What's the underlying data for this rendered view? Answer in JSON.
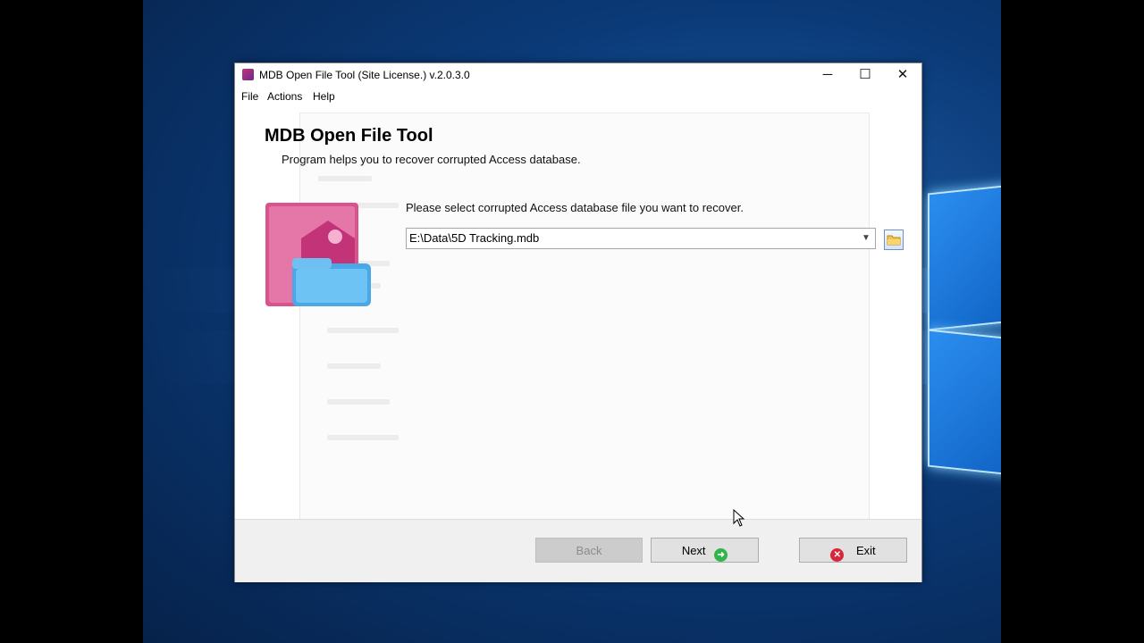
{
  "window": {
    "title": "MDB Open File Tool (Site License.) v.2.0.3.0",
    "controls": {
      "minimize": "─",
      "maximize": "☐",
      "close": "✕"
    }
  },
  "menu": [
    "File",
    "Actions",
    "Help"
  ],
  "main": {
    "heading": "MDB Open File Tool",
    "subheading": "Program helps you to recover corrupted Access database.",
    "prompt": "Please select corrupted Access database file you want to recover.",
    "file_path": "E:\\Data\\5D Tracking.mdb"
  },
  "buttons": {
    "back": "Back",
    "next": "Next",
    "exit": "Exit"
  },
  "icons": {
    "app": "mdb-app-icon",
    "logo": "access-key-folder-icon",
    "browse": "folder-icon",
    "next": "arrow-right-icon",
    "exit": "close-circle-icon",
    "dropdown": "chevron-down-icon"
  },
  "colors": {
    "accent_green": "#2fb54a",
    "exit_red": "#d8263a",
    "desktop_blue": "#0b3a78"
  }
}
